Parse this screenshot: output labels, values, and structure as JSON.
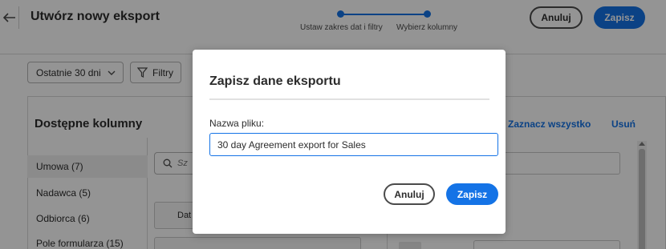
{
  "header": {
    "title": "Utwórz nowy eksport",
    "steps": [
      {
        "label": "Ustaw zakres dat i filtry"
      },
      {
        "label": "Wybierz kolumny"
      }
    ],
    "cancel_label": "Anuluj",
    "save_label": "Zapisz"
  },
  "toolbar": {
    "date_range": "Ostatnie 30 dni",
    "filters_label": "Filtry"
  },
  "columns_panel": {
    "title": "Dostępne kolumny",
    "categories": [
      {
        "label": "Umowa (7)",
        "active": true
      },
      {
        "label": "Nadawca (5)",
        "active": false
      },
      {
        "label": "Odbiorca (6)",
        "active": false
      },
      {
        "label": "Pole formularza (15)",
        "active": false
      }
    ],
    "search_placeholder": "Sz",
    "card_partial_label": "Dat",
    "select_all_label": "Zaznacz wszystko",
    "remove_label": "Usuń"
  },
  "modal": {
    "title": "Zapisz dane eksportu",
    "field_label": "Nazwa pliku:",
    "field_value": "30 day Agreement export for Sales",
    "cancel_label": "Anuluj",
    "save_label": "Zapisz"
  },
  "colors": {
    "accent": "#1473e6",
    "overlay": "#6b6b6b",
    "text": "#2c2c2c"
  },
  "icons": [
    "back-arrow-icon",
    "chevron-down-icon",
    "filter-icon",
    "search-icon",
    "checkmark-icon",
    "scroll-up-icon"
  ]
}
